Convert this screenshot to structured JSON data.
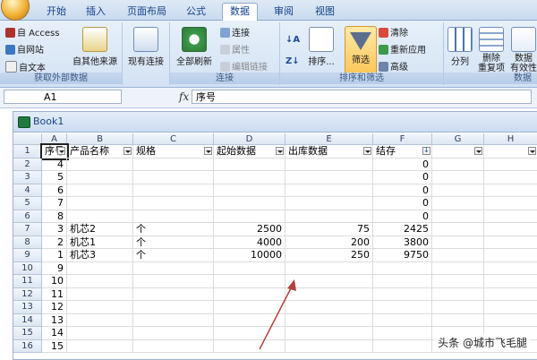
{
  "tabs": [
    "开始",
    "插入",
    "页面布局",
    "公式",
    "数据",
    "审阅",
    "视图"
  ],
  "active_tab": "数据",
  "ribbon": {
    "get_external": {
      "access": "自 Access",
      "web": "自网站",
      "text": "自文本",
      "other": "自其他来源",
      "existing": "现有连接",
      "label": "获取外部数据"
    },
    "connections": {
      "refresh_all": "全部刷新",
      "connections": "连接",
      "properties": "属性",
      "edit_links": "编辑链接",
      "label": "连接"
    },
    "sort_filter": {
      "sort": "排序...",
      "filter": "筛选",
      "clear": "清除",
      "reapply": "重新应用",
      "advanced": "高级",
      "label": "排序和筛选"
    },
    "tools": {
      "split": "分列",
      "remove_dup": "删除\n重复项",
      "validation": "数据\n有效性",
      "label": "数据"
    }
  },
  "formula_bar": {
    "name_box": "A1",
    "fx": "fx",
    "formula": "序号"
  },
  "workbook": {
    "title": "Book1"
  },
  "columns": [
    "A",
    "B",
    "C",
    "D",
    "E",
    "F",
    "G",
    "H"
  ],
  "headers": [
    "序号",
    "产品名称",
    "规格",
    "起始数据",
    "出库数据",
    "结存",
    "",
    ""
  ],
  "row_numbers": [
    "1",
    "2",
    "3",
    "4",
    "5",
    "6",
    "7",
    "8",
    "9",
    "10",
    "11",
    "12",
    "13",
    "14",
    "15",
    "16"
  ],
  "rows": [
    [
      "4",
      "",
      "",
      "",
      "",
      "0"
    ],
    [
      "5",
      "",
      "",
      "",
      "",
      "0"
    ],
    [
      "6",
      "",
      "",
      "",
      "",
      "0"
    ],
    [
      "7",
      "",
      "",
      "",
      "",
      "0"
    ],
    [
      "8",
      "",
      "",
      "",
      "",
      "0"
    ],
    [
      "3",
      "机芯2",
      "个",
      "2500",
      "75",
      "2425"
    ],
    [
      "2",
      "机芯1",
      "个",
      "4000",
      "200",
      "3800"
    ],
    [
      "1",
      "机芯3",
      "个",
      "10000",
      "250",
      "9750"
    ],
    [
      "9",
      "",
      "",
      "",
      "",
      ""
    ],
    [
      "10",
      "",
      "",
      "",
      "",
      ""
    ],
    [
      "11",
      "",
      "",
      "",
      "",
      ""
    ],
    [
      "12",
      "",
      "",
      "",
      "",
      ""
    ],
    [
      "13",
      "",
      "",
      "",
      "",
      ""
    ],
    [
      "14",
      "",
      "",
      "",
      "",
      ""
    ],
    [
      "15",
      "",
      "",
      "",
      "",
      ""
    ]
  ],
  "watermark": "头条 @城市飞毛腿"
}
